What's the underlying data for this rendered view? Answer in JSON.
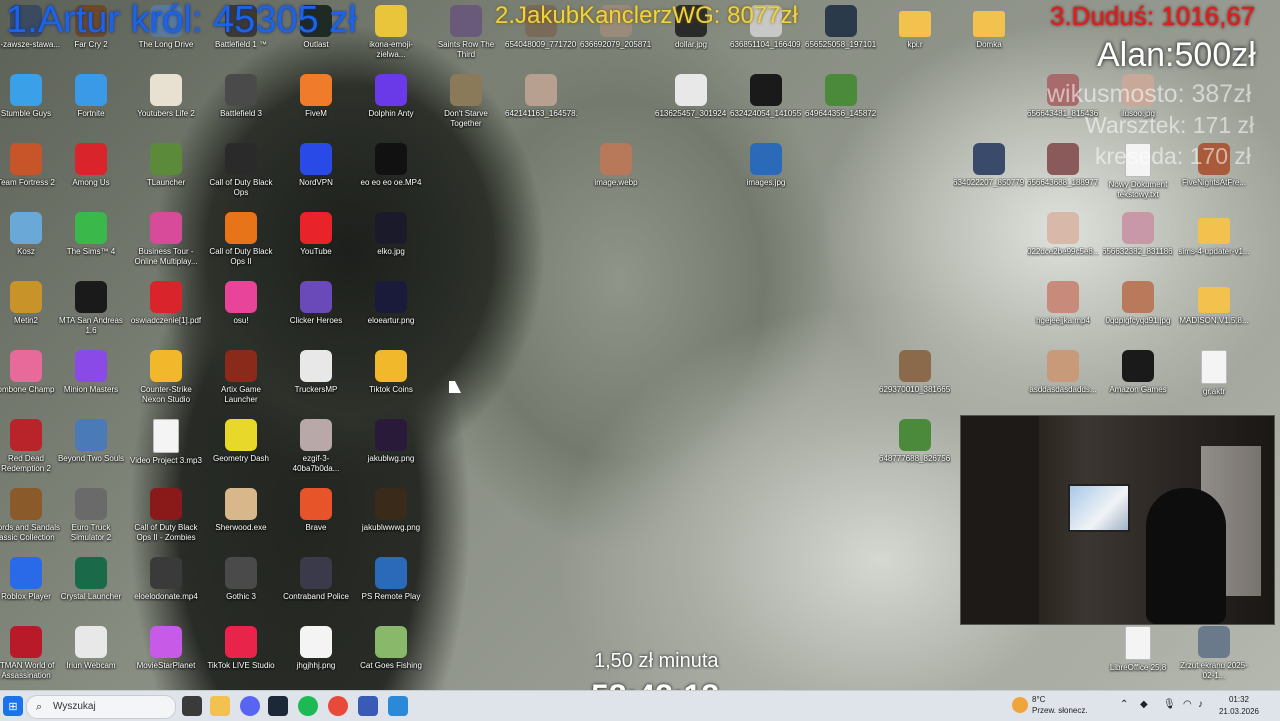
{
  "overlay": {
    "leader1": "1.Artur król: 45305 zł",
    "leader2": "2.JakubKanclerzWG: 8077zł",
    "leader3": "3.Duduś: 1016,67",
    "alan": "Alan:500zł",
    "wikusmosto": "wikusmosto: 387zł",
    "warsztek": "Warsztek: 171 zł",
    "kreseda": "kreseda: 170 zł",
    "rate": "1,50 zł minuta",
    "timer": "58:48:18"
  },
  "desktop": {
    "icons": [
      {
        "label": "dk-zawsze-stawa...",
        "icon": "game-icon",
        "color": "#3b4a5e"
      },
      {
        "label": "Far Cry 2",
        "icon": "game-icon",
        "color": "#6b4a2a"
      },
      {
        "label": "The Long Drive",
        "icon": "game-icon",
        "color": "#5a7a9a"
      },
      {
        "label": "Battlefield 1 ™",
        "icon": "game-icon",
        "color": "#3d3a33"
      },
      {
        "label": "Outlast",
        "icon": "game-icon",
        "color": "#1f2a22"
      },
      {
        "label": "ikona-emoji-zielwa...",
        "icon": "emoji-icon",
        "color": "#e8c53a"
      },
      {
        "label": "Saints Row The Third",
        "icon": "game-icon",
        "color": "#6a5a7a"
      },
      {
        "label": "654048009_771720...",
        "icon": "image-file-icon",
        "color": "#7a6a5a"
      },
      {
        "label": "636692079_205871...",
        "icon": "image-file-icon",
        "color": "#9a8a7a"
      },
      {
        "label": "dollar.jpg",
        "icon": "image-file-icon",
        "color": "#2a2a2a"
      },
      {
        "label": "636851104_166409...",
        "icon": "image-file-icon",
        "color": "#c8c8c8"
      },
      {
        "label": "656525058_197101...",
        "icon": "image-file-icon",
        "color": "#2a3a4a"
      },
      {
        "label": "kpi.r",
        "icon": "folder-icon",
        "color": "#f2c14e"
      },
      {
        "label": "Domka",
        "icon": "folder-icon",
        "color": "#f2c14e"
      },
      {
        "label": "Stumble Guys",
        "icon": "game-icon",
        "color": "#3aa0e8"
      },
      {
        "label": "Fortnite",
        "icon": "game-icon",
        "color": "#3a9ae8"
      },
      {
        "label": "Youtubers Life 2",
        "icon": "game-icon",
        "color": "#e8e0d0"
      },
      {
        "label": "Battlefield 3",
        "icon": "game-icon",
        "color": "#4a4a4a"
      },
      {
        "label": "FiveM",
        "icon": "game-icon",
        "color": "#f07b2a"
      },
      {
        "label": "Dolphin Anty",
        "icon": "browser-icon",
        "color": "#6a3ae8"
      },
      {
        "label": "Don't Starve Together",
        "icon": "game-icon",
        "color": "#8a7a5a"
      },
      {
        "label": "642141163_164578...",
        "icon": "image-file-icon",
        "color": "#b8a090"
      },
      {
        "label": "613625457_301924...",
        "icon": "image-file-icon",
        "color": "#e8e8e8"
      },
      {
        "label": "632424054_141055...",
        "icon": "image-file-icon",
        "color": "#1a1a1a"
      },
      {
        "label": "649644356_145872...",
        "icon": "image-file-icon",
        "color": "#4a8a3a"
      },
      {
        "label": "656643481_815436...",
        "icon": "image-file-icon",
        "color": "#a86a6a"
      },
      {
        "label": "ilusoo.jpg",
        "icon": "image-file-icon",
        "color": "#c8a898"
      },
      {
        "label": "Team Fortress 2",
        "icon": "game-icon",
        "color": "#c8542a"
      },
      {
        "label": "Among Us",
        "icon": "game-icon",
        "color": "#d8242a"
      },
      {
        "label": "TLauncher",
        "icon": "game-icon",
        "color": "#5a8a3a"
      },
      {
        "label": "Call of Duty Black Ops",
        "icon": "game-icon",
        "color": "#2a2a2a"
      },
      {
        "label": "NordVPN",
        "icon": "vpn-icon",
        "color": "#2a4ae8"
      },
      {
        "label": "eo eo eo oe.MP4",
        "icon": "video-file-icon",
        "color": "#111111"
      },
      {
        "label": "image.webp",
        "icon": "image-file-icon",
        "color": "#b8785a"
      },
      {
        "label": "images.jpg",
        "icon": "image-file-icon",
        "color": "#2a6ab8"
      },
      {
        "label": "634022207_850779...",
        "icon": "image-file-icon",
        "color": "#3a4a6a"
      },
      {
        "label": "656643688_188977...",
        "icon": "image-file-icon",
        "color": "#8a5a5a"
      },
      {
        "label": "Nowy Dokument tekstowy.txt",
        "icon": "text-file-icon",
        "color": "#f4f4f4"
      },
      {
        "label": "FiveNightsAtFre...",
        "icon": "image-file-icon",
        "color": "#a85a3a"
      },
      {
        "label": "Kosz",
        "icon": "recycle-bin-icon",
        "color": "#6aa8d8"
      },
      {
        "label": "The Sims™ 4",
        "icon": "game-icon",
        "color": "#3ab84a"
      },
      {
        "label": "Business Tour - Online Multiplay...",
        "icon": "game-icon",
        "color": "#d84a9a"
      },
      {
        "label": "Call of Duty Black Ops II",
        "icon": "game-icon",
        "color": "#e8741a"
      },
      {
        "label": "YouTube",
        "icon": "youtube-icon",
        "color": "#e8242a"
      },
      {
        "label": "elko.jpg",
        "icon": "image-file-icon",
        "color": "#1a1a2a"
      },
      {
        "label": "022dce2be99c5e8...",
        "icon": "image-file-icon",
        "color": "#d8b8a8"
      },
      {
        "label": "656632382_831186...",
        "icon": "image-file-icon",
        "color": "#c898a8"
      },
      {
        "label": "sims-4-updater-v1...",
        "icon": "folder-icon",
        "color": "#f2c14e"
      },
      {
        "label": "Metin2",
        "icon": "game-icon",
        "color": "#c8942a"
      },
      {
        "label": "MTA San Andreas 1.6",
        "icon": "game-icon",
        "color": "#1a1a1a"
      },
      {
        "label": "oswiadczenie[1].pdf",
        "icon": "pdf-icon",
        "color": "#d8242a"
      },
      {
        "label": "osu!",
        "icon": "osu-icon",
        "color": "#e8449a"
      },
      {
        "label": "Clicker Heroes",
        "icon": "game-icon",
        "color": "#6a4ab8"
      },
      {
        "label": "eloeartur.png",
        "icon": "image-file-icon",
        "color": "#1a1a3a"
      },
      {
        "label": "hgejeejjka.mp4",
        "icon": "video-file-icon",
        "color": "#c88a7a"
      },
      {
        "label": "0qdpigfcyqd91.jpg",
        "icon": "image-file-icon",
        "color": "#b87a5a"
      },
      {
        "label": "MADISON.V1.5.8...",
        "icon": "folder-icon",
        "color": "#f2c14e"
      },
      {
        "label": "ombone Champ",
        "icon": "game-icon",
        "color": "#e86a9a"
      },
      {
        "label": "Minion Masters",
        "icon": "game-icon",
        "color": "#8a4ae8"
      },
      {
        "label": "Counter-Strike Nexon Studio",
        "icon": "game-icon",
        "color": "#f0b82a"
      },
      {
        "label": "Artix Game Launcher",
        "icon": "game-icon",
        "color": "#8a2a1a"
      },
      {
        "label": "TruckersMP",
        "icon": "game-icon",
        "color": "#e8e8e8"
      },
      {
        "label": "Tiktok Coins",
        "icon": "coins-icon",
        "color": "#f0b82a"
      },
      {
        "label": "629370010_381665...",
        "icon": "image-file-icon",
        "color": "#8a6a4a"
      },
      {
        "label": "asddasdasdadds...",
        "icon": "image-file-icon",
        "color": "#c89a7a"
      },
      {
        "label": "Amazon Games",
        "icon": "amazon-games-icon",
        "color": "#1a1a1a"
      },
      {
        "label": "gr.aktr",
        "icon": "text-file-icon",
        "color": "#f4f4f4"
      },
      {
        "label": "Red Dead Redemption 2",
        "icon": "game-icon",
        "color": "#b8242a"
      },
      {
        "label": "Beyond Two Souls",
        "icon": "game-icon",
        "color": "#4a7ab8"
      },
      {
        "label": "Video Project 3.mp3",
        "icon": "audio-file-icon",
        "color": "#f4f4f4"
      },
      {
        "label": "Geometry Dash",
        "icon": "game-icon",
        "color": "#e8d82a"
      },
      {
        "label": "ezgif-3-40ba7b0da...",
        "icon": "image-file-icon",
        "color": "#b8a8a8"
      },
      {
        "label": "jakublwg.png",
        "icon": "image-file-icon",
        "color": "#2a1a3a"
      },
      {
        "label": "648777688_826756...",
        "icon": "image-file-icon",
        "color": "#4a8a3a"
      },
      {
        "label": "words and Sandals lassic Collection",
        "icon": "game-icon",
        "color": "#8a5a2a"
      },
      {
        "label": "Euro Truck Simulator 2",
        "icon": "game-icon",
        "color": "#6a6a6a"
      },
      {
        "label": "Call of Duty Black Ops II - Zombies",
        "icon": "game-icon",
        "color": "#8a1a1a"
      },
      {
        "label": "Sherwood.exe",
        "icon": "game-icon",
        "color": "#d8b88a"
      },
      {
        "label": "Brave",
        "icon": "brave-icon",
        "color": "#e8542a"
      },
      {
        "label": "jakublwwwg.png",
        "icon": "image-file-icon",
        "color": "#3a2a1a"
      },
      {
        "label": "Roblox Player",
        "icon": "roblox-icon",
        "color": "#2a6ae8"
      },
      {
        "label": "Crystal Launcher",
        "icon": "game-icon",
        "color": "#1a6a4a"
      },
      {
        "label": "eloelodonate.mp4",
        "icon": "video-file-icon",
        "color": "#3a3a3a"
      },
      {
        "label": "Gothic 3",
        "icon": "game-icon",
        "color": "#4a4a4a"
      },
      {
        "label": "Contraband Police",
        "icon": "game-icon",
        "color": "#3a3a4a"
      },
      {
        "label": "PS Remote Play",
        "icon": "playstation-icon",
        "color": "#2a6ab8"
      },
      {
        "label": "ITMAN World of Assassination",
        "icon": "game-icon",
        "color": "#b81a2a"
      },
      {
        "label": "Iriun Webcam",
        "icon": "webcam-icon",
        "color": "#e8e8e8"
      },
      {
        "label": "MovieStarPlanet",
        "icon": "game-icon",
        "color": "#c85ae8"
      },
      {
        "label": "TikTok LIVE Studio",
        "icon": "tiktok-icon",
        "color": "#e8244a"
      },
      {
        "label": "jhgjhhj.png",
        "icon": "image-file-icon",
        "color": "#f4f4f4"
      },
      {
        "label": "Cat Goes Fishing",
        "icon": "game-icon",
        "color": "#8ab86a"
      },
      {
        "label": "LibreOffice 25.8",
        "icon": "document-icon",
        "color": "#f4f4f4"
      },
      {
        "label": "Zrzut ekranu 2025-02-1...",
        "icon": "image-file-icon",
        "color": "#6a7a8a"
      }
    ]
  },
  "taskbar": {
    "search_placeholder": "Wyszukaj",
    "weather_temp": "8°C",
    "weather_desc": "Przew. słonecz.",
    "time": "01:32",
    "date": "21.03.2026",
    "apps": [
      {
        "name": "windows-start-icon",
        "color": "#1a73e8"
      },
      {
        "name": "task-view-icon",
        "color": "#3a3a3a"
      },
      {
        "name": "file-explorer-icon",
        "color": "#f2c14e"
      },
      {
        "name": "discord-icon",
        "color": "#5865f2"
      },
      {
        "name": "steam-icon",
        "color": "#1b2838"
      },
      {
        "name": "spotify-icon",
        "color": "#1db954"
      },
      {
        "name": "chrome-icon",
        "color": "#e84a3a"
      },
      {
        "name": "pen-icon",
        "color": "#3a5ab8"
      },
      {
        "name": "paint-icon",
        "color": "#2a8ad8"
      }
    ]
  }
}
